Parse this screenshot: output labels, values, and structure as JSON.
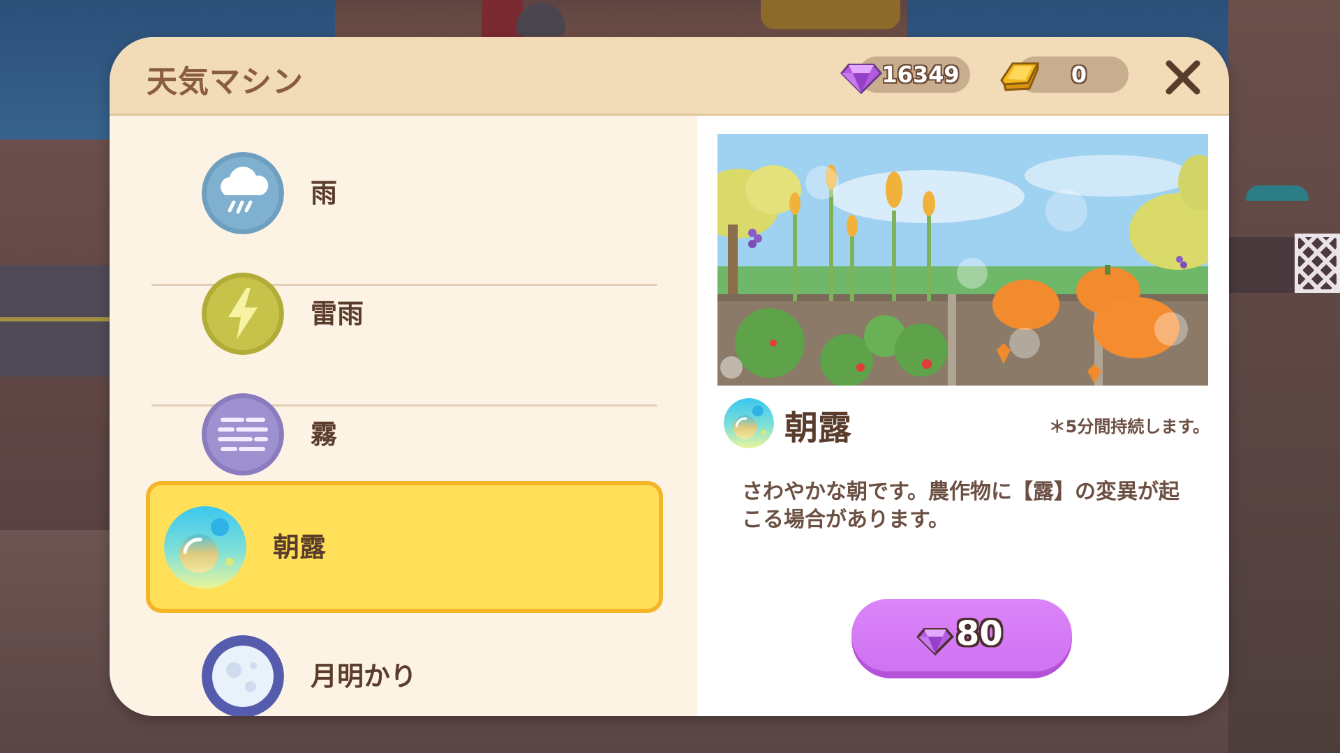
{
  "window": {
    "title": "天気マシン"
  },
  "currency": {
    "gems": "16349",
    "gold": "0",
    "gem_icon": "purple-gem-icon",
    "gold_icon": "gold-bar-icon"
  },
  "weather_list": [
    {
      "label": "雨",
      "icon": "rain-cloud-icon",
      "color": "#6e9fc0"
    },
    {
      "label": "雷雨",
      "icon": "lightning-icon",
      "color": "#b9b33b"
    },
    {
      "label": "霧",
      "icon": "fog-icon",
      "color": "#9384c4"
    },
    {
      "label": "朝露",
      "icon": "dew-bubble-icon",
      "color": "#62d8de",
      "selected": true
    },
    {
      "label": "月明かり",
      "icon": "moon-icon",
      "color": "#5a61b3"
    }
  ],
  "detail": {
    "name": "朝露",
    "duration": "＊5分間持続します。",
    "description": "さわやかな朝です。農作物に【露】の変異が起こる場合があります。",
    "price": "80"
  },
  "colors": {
    "header_bg": "#f2dcb8",
    "selected_bg": "#ffe058",
    "selected_border": "#f6b429",
    "buy_button": "#d67cf8",
    "text_brown": "#5a3c2c"
  }
}
